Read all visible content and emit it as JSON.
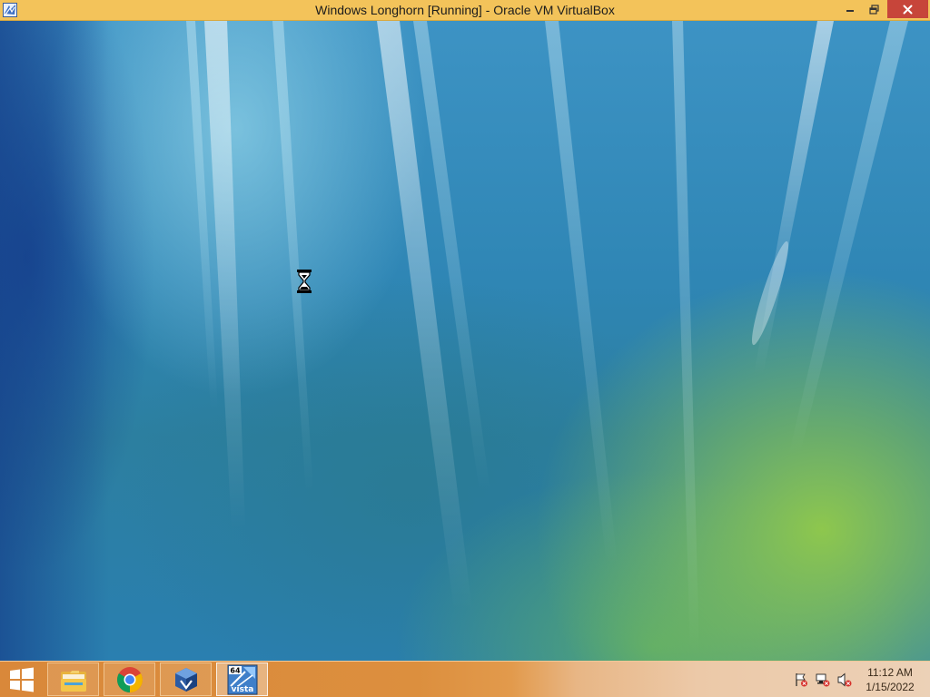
{
  "window": {
    "title": "Windows Longhorn [Running] - Oracle VM VirtualBox",
    "app_icon": "virtualbox-app-icon",
    "controls": {
      "minimize": "minimize-icon",
      "restore": "restore-icon",
      "close": "close-icon"
    }
  },
  "desktop": {
    "wallpaper": "aurora-wallpaper",
    "cursor": "hourglass-cursor-icon"
  },
  "taskbar": {
    "start": "windows-logo-icon",
    "pinned": [
      {
        "name": "file-explorer",
        "icon": "folder-icon"
      },
      {
        "name": "google-chrome",
        "icon": "chrome-icon"
      },
      {
        "name": "virtualbox",
        "icon": "virtualbox-icon"
      },
      {
        "name": "windows-vista-vm",
        "icon": "vista-64-icon",
        "active": true,
        "badge": "64",
        "label": "vista"
      }
    ],
    "tray": [
      {
        "name": "action-center",
        "icon": "flag-icon"
      },
      {
        "name": "network",
        "icon": "network-icon"
      },
      {
        "name": "volume",
        "icon": "volume-muted-icon"
      }
    ],
    "clock": {
      "time": "11:12 AM",
      "date": "1/15/2022"
    }
  },
  "colors": {
    "titlebar": "#f3c35a",
    "close_button": "#c7453a",
    "taskbar_left": "#d9883a",
    "taskbar_right": "#ecd1b7"
  }
}
